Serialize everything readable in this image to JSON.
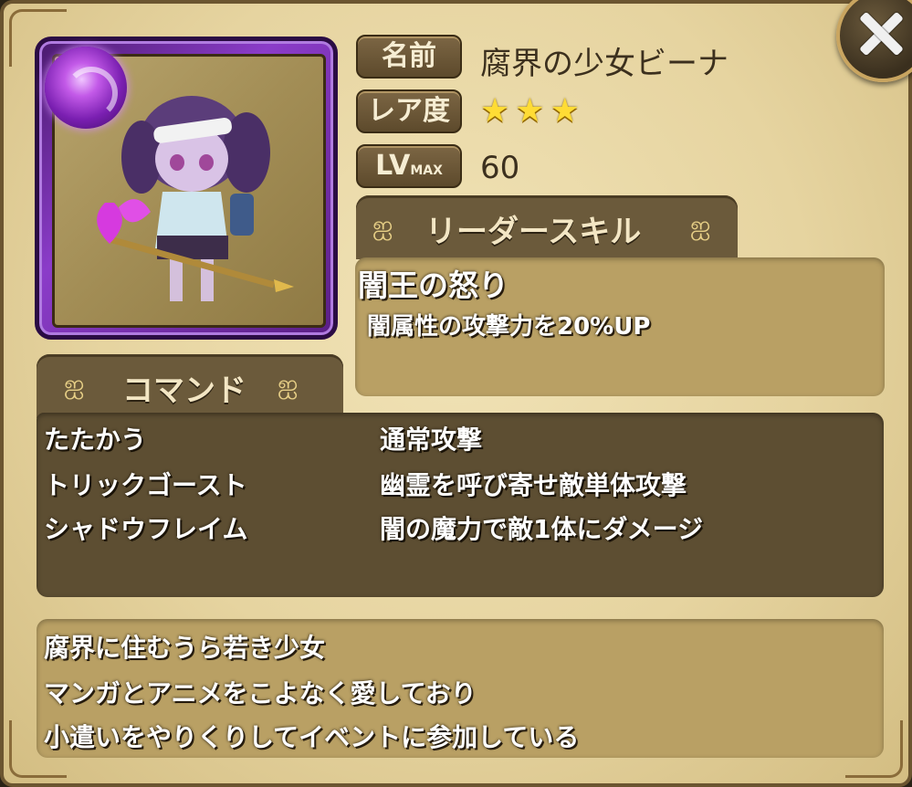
{
  "close_button": {
    "icon": "close-icon"
  },
  "character": {
    "portrait_alt": "character-portrait",
    "element_orb": "dark-element-orb-icon"
  },
  "profile": {
    "name_label": "名前",
    "name_value": "腐界の少女ビーナ",
    "rarity_label": "レア度",
    "rarity_stars": 3,
    "level_label": "LV",
    "level_label_suffix": "MAX",
    "level_max": "60"
  },
  "leader_skill": {
    "tab_label": "リーダースキル",
    "name": "闇王の怒り",
    "description": "闇属性の攻撃力を20%UP"
  },
  "commands": {
    "tab_label": "コマンド",
    "items": [
      {
        "name": "たたかう",
        "description": "通常攻撃"
      },
      {
        "name": "トリックゴースト",
        "description": "幽霊を呼び寄せ敵単体攻撃"
      },
      {
        "name": "シャドウフレイム",
        "description": "闇の魔力で敵1体にダメージ"
      }
    ]
  },
  "flavor_text": [
    "腐界に住むうら若き少女",
    "マンガとアニメをこよなく愛しており",
    "小遣いをやりくりしてイベントに参加している"
  ],
  "colors": {
    "panel_bg": "#e6d4a0",
    "tab_bg": "#6b5a3b",
    "command_box_bg": "#5d4e32",
    "text_box_bg": "#b9a064",
    "portrait_frame": "#8b3cc9",
    "star": "#ffdc35"
  }
}
